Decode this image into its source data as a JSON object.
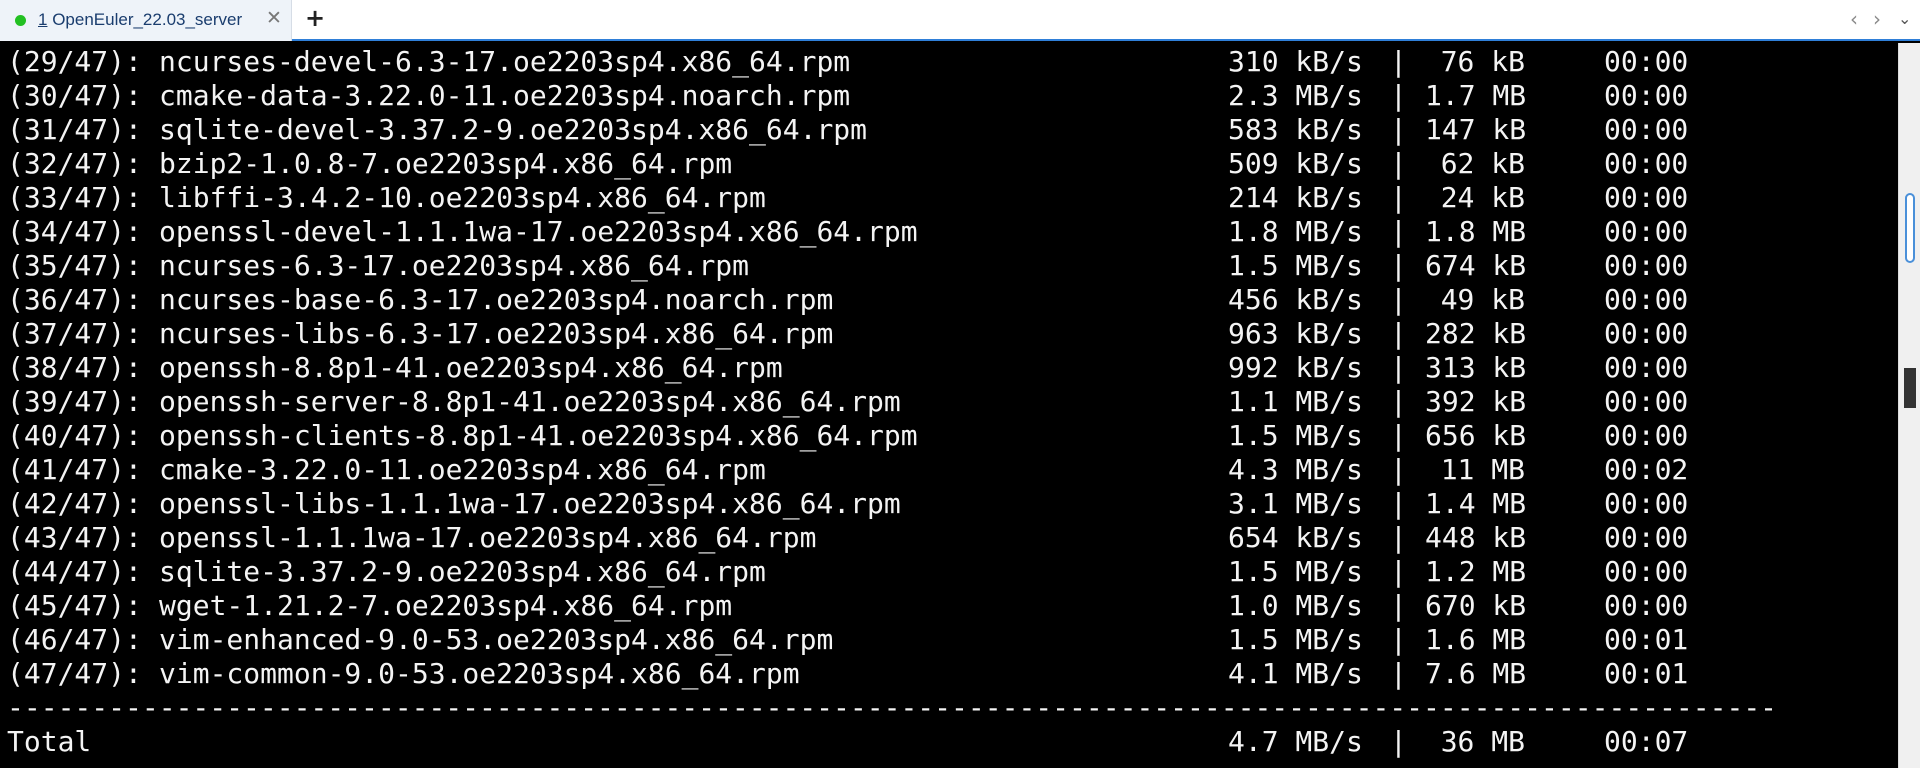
{
  "app": {
    "tab": {
      "number": "1",
      "title": "OpenEuler_22.03_server",
      "status_color": "#22c022",
      "close_icon": "close-icon"
    },
    "new_tab_icon": "plus-icon",
    "nav": {
      "left_icon": "chevron-left-icon",
      "right_icon": "chevron-right-icon",
      "menu_icon": "chevron-down-icon"
    }
  },
  "terminal": {
    "rows": [
      {
        "index": "(29/47):",
        "package": "ncurses-devel-6.3-17.oe2203sp4.x86_64.rpm",
        "rate": "310 kB/s",
        "size": "76 kB",
        "time": "00:00"
      },
      {
        "index": "(30/47):",
        "package": "cmake-data-3.22.0-11.oe2203sp4.noarch.rpm",
        "rate": "2.3 MB/s",
        "size": "1.7 MB",
        "time": "00:00"
      },
      {
        "index": "(31/47):",
        "package": "sqlite-devel-3.37.2-9.oe2203sp4.x86_64.rpm",
        "rate": "583 kB/s",
        "size": "147 kB",
        "time": "00:00"
      },
      {
        "index": "(32/47):",
        "package": "bzip2-1.0.8-7.oe2203sp4.x86_64.rpm",
        "rate": "509 kB/s",
        "size": "62 kB",
        "time": "00:00"
      },
      {
        "index": "(33/47):",
        "package": "libffi-3.4.2-10.oe2203sp4.x86_64.rpm",
        "rate": "214 kB/s",
        "size": "24 kB",
        "time": "00:00"
      },
      {
        "index": "(34/47):",
        "package": "openssl-devel-1.1.1wa-17.oe2203sp4.x86_64.rpm",
        "rate": "1.8 MB/s",
        "size": "1.8 MB",
        "time": "00:00"
      },
      {
        "index": "(35/47):",
        "package": "ncurses-6.3-17.oe2203sp4.x86_64.rpm",
        "rate": "1.5 MB/s",
        "size": "674 kB",
        "time": "00:00"
      },
      {
        "index": "(36/47):",
        "package": "ncurses-base-6.3-17.oe2203sp4.noarch.rpm",
        "rate": "456 kB/s",
        "size": "49 kB",
        "time": "00:00"
      },
      {
        "index": "(37/47):",
        "package": "ncurses-libs-6.3-17.oe2203sp4.x86_64.rpm",
        "rate": "963 kB/s",
        "size": "282 kB",
        "time": "00:00"
      },
      {
        "index": "(38/47):",
        "package": "openssh-8.8p1-41.oe2203sp4.x86_64.rpm",
        "rate": "992 kB/s",
        "size": "313 kB",
        "time": "00:00"
      },
      {
        "index": "(39/47):",
        "package": "openssh-server-8.8p1-41.oe2203sp4.x86_64.rpm",
        "rate": "1.1 MB/s",
        "size": "392 kB",
        "time": "00:00"
      },
      {
        "index": "(40/47):",
        "package": "openssh-clients-8.8p1-41.oe2203sp4.x86_64.rpm",
        "rate": "1.5 MB/s",
        "size": "656 kB",
        "time": "00:00"
      },
      {
        "index": "(41/47):",
        "package": "cmake-3.22.0-11.oe2203sp4.x86_64.rpm",
        "rate": "4.3 MB/s",
        "size": "11 MB",
        "time": "00:02"
      },
      {
        "index": "(42/47):",
        "package": "openssl-libs-1.1.1wa-17.oe2203sp4.x86_64.rpm",
        "rate": "3.1 MB/s",
        "size": "1.4 MB",
        "time": "00:00"
      },
      {
        "index": "(43/47):",
        "package": "openssl-1.1.1wa-17.oe2203sp4.x86_64.rpm",
        "rate": "654 kB/s",
        "size": "448 kB",
        "time": "00:00"
      },
      {
        "index": "(44/47):",
        "package": "sqlite-3.37.2-9.oe2203sp4.x86_64.rpm",
        "rate": "1.5 MB/s",
        "size": "1.2 MB",
        "time": "00:00"
      },
      {
        "index": "(45/47):",
        "package": "wget-1.21.2-7.oe2203sp4.x86_64.rpm",
        "rate": "1.0 MB/s",
        "size": "670 kB",
        "time": "00:00"
      },
      {
        "index": "(46/47):",
        "package": "vim-enhanced-9.0-53.oe2203sp4.x86_64.rpm",
        "rate": "1.5 MB/s",
        "size": "1.6 MB",
        "time": "00:01"
      },
      {
        "index": "(47/47):",
        "package": "vim-common-9.0-53.oe2203sp4.x86_64.rpm",
        "rate": "4.1 MB/s",
        "size": "7.6 MB",
        "time": "00:01"
      }
    ],
    "column_separator": "|",
    "divider_char": "-",
    "total": {
      "label": "Total",
      "rate": "4.7 MB/s",
      "size": "36 MB",
      "time": "00:07"
    },
    "colors": {
      "background": "#000000",
      "foreground": "#f4f4f4"
    }
  }
}
